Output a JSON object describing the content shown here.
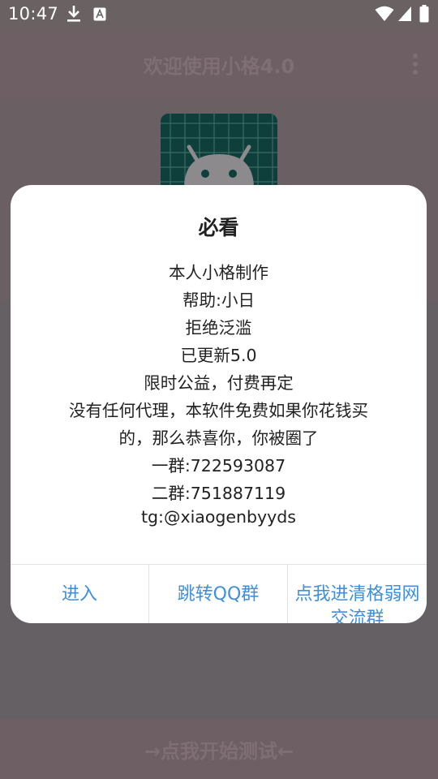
{
  "status_bar": {
    "time": "10:47",
    "icons": [
      "download-icon",
      "font-notification-icon",
      "wifi-icon",
      "signal-icon",
      "battery-icon"
    ]
  },
  "app": {
    "title": "欢迎使用小格4.0",
    "menu_icon": "overflow-menu-icon",
    "logo_icon": "android-robot-icon",
    "start_button_label": "→点我开始测试←"
  },
  "dialog": {
    "title": "必看",
    "message_lines": [
      "本人小格制作",
      "帮助:小日",
      "拒绝泛滥",
      "已更新5.0",
      "限时公益，付费再定",
      "没有任何代理，本软件免费如果你花钱买",
      "的，那么恭喜你，你被圈了",
      "一群:722593087",
      "二群:751887119",
      "tg:@xiaogenbyyds"
    ],
    "buttons": {
      "enter": "进入",
      "jump_qq": "跳转QQ群",
      "join_group": "点我进清格弱网交流群"
    }
  },
  "colors": {
    "dialog_button_text": "#3f8fdc",
    "scrim": "#6a6163",
    "logo_background": "#0f3f3a"
  }
}
